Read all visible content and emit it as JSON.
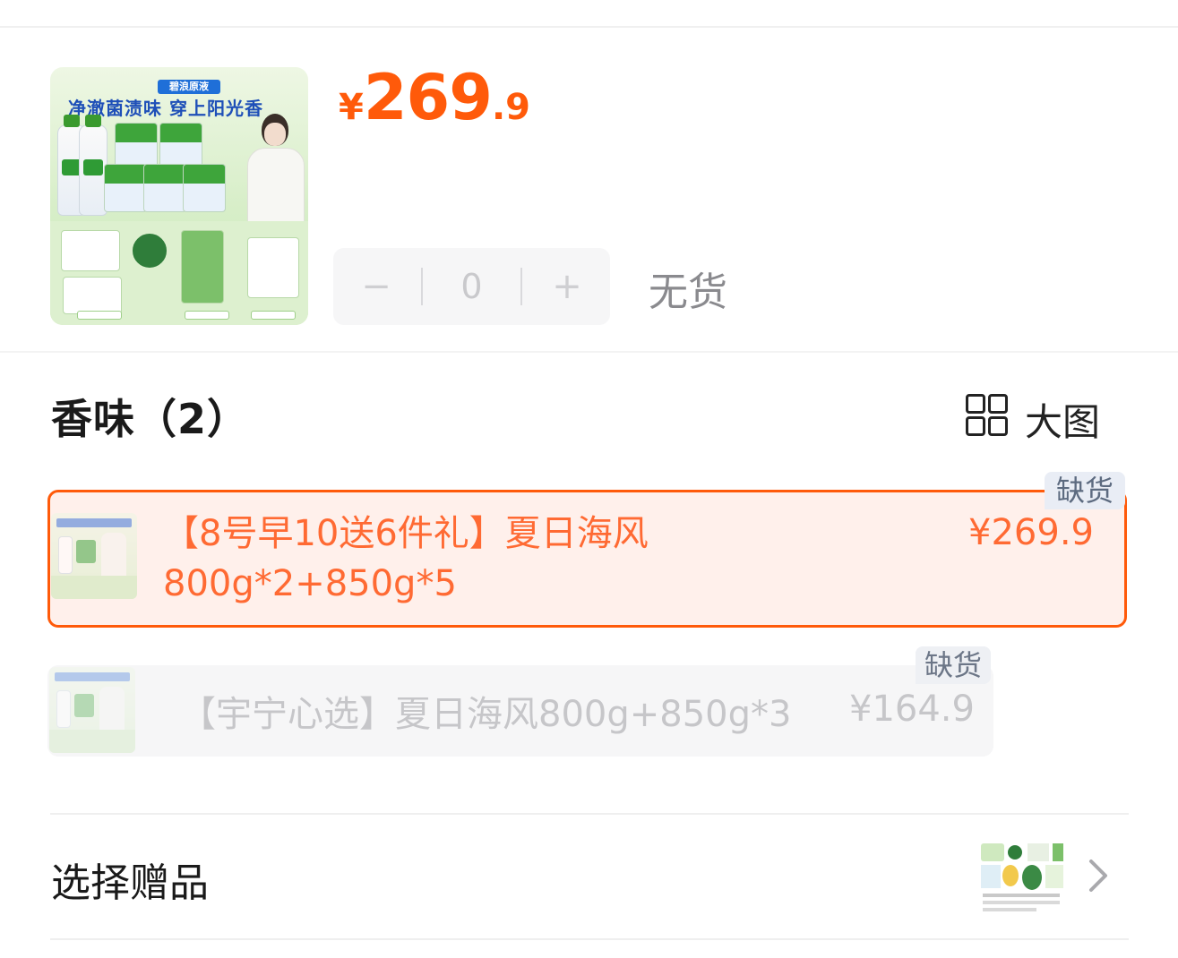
{
  "product": {
    "image_alt": "碧浪原液 净澈菌渍味 穿上阳光香",
    "image_tag": "碧浪原液",
    "image_title": "净澈菌渍味 穿上阳光香",
    "price": {
      "currency": "¥",
      "integer": "269",
      "decimal": ".9"
    }
  },
  "quantity": {
    "minus": "−",
    "value": "0",
    "plus": "+",
    "stock_status": "无货"
  },
  "scent": {
    "title": "香味（2）",
    "view_toggle_label": "大图",
    "view_toggle_icon": "grid-icon",
    "options": [
      {
        "text": "【8号早10送6件礼】夏日海风800g*2+850g*5",
        "price": "¥269.9",
        "badge": "缺货",
        "selected": true
      },
      {
        "text": "【宇宁心选】夏日海风800g+850g*3",
        "price": "¥164.9",
        "badge": "缺货",
        "selected": false
      }
    ]
  },
  "gift": {
    "label": "选择赠品",
    "chevron_icon": "chevron-right-icon"
  },
  "colors": {
    "accent": "#ff5a0a",
    "selected_bg": "#fff0eb",
    "disabled_text": "#c6c6c9"
  }
}
